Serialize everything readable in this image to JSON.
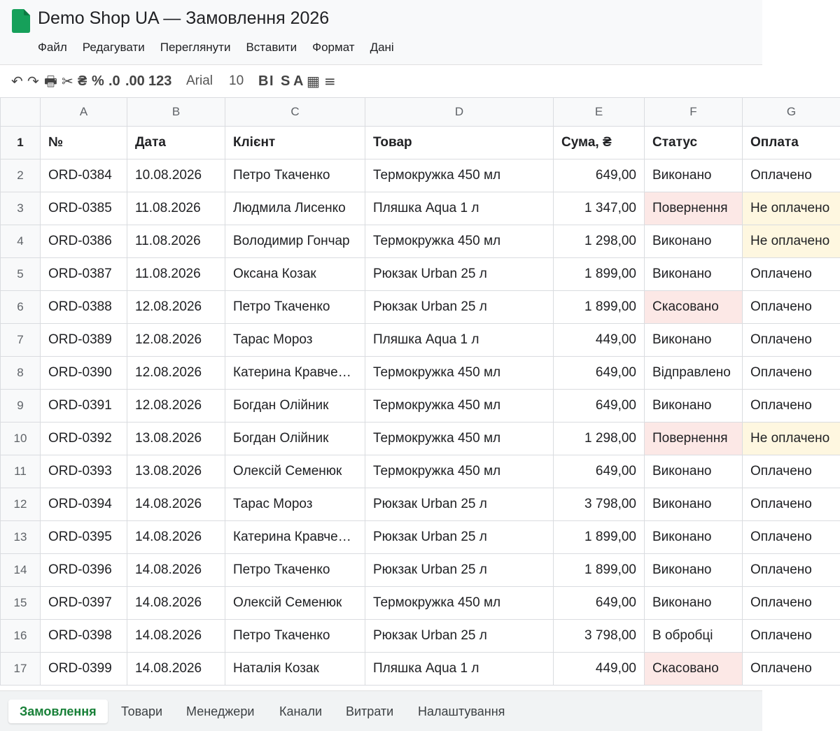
{
  "app": {
    "title": "Demo Shop UA — Замовлення 2026",
    "brand_color": "#16a05a"
  },
  "menu": [
    "Файл",
    "Редагувати",
    "Переглянути",
    "Вставити",
    "Формат",
    "Дані"
  ],
  "toolbar": {
    "undo": "↶",
    "redo": "↷",
    "print": "🖶",
    "cut": "✂",
    "currency": "₴",
    "percent": "%",
    "dec_less": ".0",
    "dec_more": ".00",
    "number_format": "123",
    "font": "Arial",
    "font_size": "10",
    "bold": "B",
    "italic": "I",
    "strike": "S",
    "text_color": "A",
    "borders": "▦",
    "align": "≡"
  },
  "columns": [
    "A",
    "B",
    "C",
    "D",
    "E",
    "F",
    "G"
  ],
  "header_row": {
    "num": "1",
    "cells": [
      "№",
      "Дата",
      "Клієнт",
      "Товар",
      "Сума, ₴",
      "Статус",
      "Оплата"
    ]
  },
  "rows": [
    {
      "num": "2",
      "id": "ORD-0384",
      "date": "10.08.2026",
      "client": "Петро Ткаченко",
      "product": "Термокружка 450 мл",
      "sum": "649,00",
      "status": "Виконано",
      "payment": "Оплачено"
    },
    {
      "num": "3",
      "id": "ORD-0385",
      "date": "11.08.2026",
      "client": "Людмила Лисенко",
      "product": "Пляшка Aqua 1 л",
      "sum": "1 347,00",
      "status": "Повернення",
      "payment": "Не оплачено"
    },
    {
      "num": "4",
      "id": "ORD-0386",
      "date": "11.08.2026",
      "client": "Володимир Гончар",
      "product": "Термокружка 450 мл",
      "sum": "1 298,00",
      "status": "Виконано",
      "payment": "Не оплачено"
    },
    {
      "num": "5",
      "id": "ORD-0387",
      "date": "11.08.2026",
      "client": "Оксана Козак",
      "product": "Рюкзак Urban 25 л",
      "sum": "1 899,00",
      "status": "Виконано",
      "payment": "Оплачено"
    },
    {
      "num": "6",
      "id": "ORD-0388",
      "date": "12.08.2026",
      "client": "Петро Ткаченко",
      "product": "Рюкзак Urban 25 л",
      "sum": "1 899,00",
      "status": "Скасовано",
      "payment": "Оплачено"
    },
    {
      "num": "7",
      "id": "ORD-0389",
      "date": "12.08.2026",
      "client": "Тарас Мороз",
      "product": "Пляшка Aqua 1 л",
      "sum": "449,00",
      "status": "Виконано",
      "payment": "Оплачено"
    },
    {
      "num": "8",
      "id": "ORD-0390",
      "date": "12.08.2026",
      "client": "Катерина Кравче…",
      "product": "Термокружка 450 мл",
      "sum": "649,00",
      "status": "Відправлено",
      "payment": "Оплачено"
    },
    {
      "num": "9",
      "id": "ORD-0391",
      "date": "12.08.2026",
      "client": "Богдан Олійник",
      "product": "Термокружка 450 мл",
      "sum": "649,00",
      "status": "Виконано",
      "payment": "Оплачено"
    },
    {
      "num": "10",
      "id": "ORD-0392",
      "date": "13.08.2026",
      "client": "Богдан Олійник",
      "product": "Термокружка 450 мл",
      "sum": "1 298,00",
      "status": "Повернення",
      "payment": "Не оплачено"
    },
    {
      "num": "11",
      "id": "ORD-0393",
      "date": "13.08.2026",
      "client": "Олексій Семенюк",
      "product": "Термокружка 450 мл",
      "sum": "649,00",
      "status": "Виконано",
      "payment": "Оплачено"
    },
    {
      "num": "12",
      "id": "ORD-0394",
      "date": "14.08.2026",
      "client": "Тарас Мороз",
      "product": "Рюкзак Urban 25 л",
      "sum": "3 798,00",
      "status": "Виконано",
      "payment": "Оплачено"
    },
    {
      "num": "13",
      "id": "ORD-0395",
      "date": "14.08.2026",
      "client": "Катерина Кравче…",
      "product": "Рюкзак Urban 25 л",
      "sum": "1 899,00",
      "status": "Виконано",
      "payment": "Оплачено"
    },
    {
      "num": "14",
      "id": "ORD-0396",
      "date": "14.08.2026",
      "client": "Петро Ткаченко",
      "product": "Рюкзак Urban 25 л",
      "sum": "1 899,00",
      "status": "Виконано",
      "payment": "Оплачено"
    },
    {
      "num": "15",
      "id": "ORD-0397",
      "date": "14.08.2026",
      "client": "Олексій Семенюк",
      "product": "Термокружка 450 мл",
      "sum": "649,00",
      "status": "Виконано",
      "payment": "Оплачено"
    },
    {
      "num": "16",
      "id": "ORD-0398",
      "date": "14.08.2026",
      "client": "Петро Ткаченко",
      "product": "Рюкзак Urban 25 л",
      "sum": "3 798,00",
      "status": "В обробці",
      "payment": "Оплачено"
    },
    {
      "num": "17",
      "id": "ORD-0399",
      "date": "14.08.2026",
      "client": "Наталія Козак",
      "product": "Пляшка Aqua 1 л",
      "sum": "449,00",
      "status": "Скасовано",
      "payment": "Оплачено"
    }
  ],
  "highlight": {
    "status_alert": [
      "Повернення",
      "Скасовано"
    ],
    "payment_alert": [
      "Не оплачено"
    ],
    "status_alert_color": "#fce8e6",
    "payment_alert_color": "#fef7e0"
  },
  "sheets": {
    "active": "Замовлення",
    "tabs": [
      "Замовлення",
      "Товари",
      "Менеджери",
      "Канали",
      "Витрати",
      "Налаштування"
    ]
  }
}
